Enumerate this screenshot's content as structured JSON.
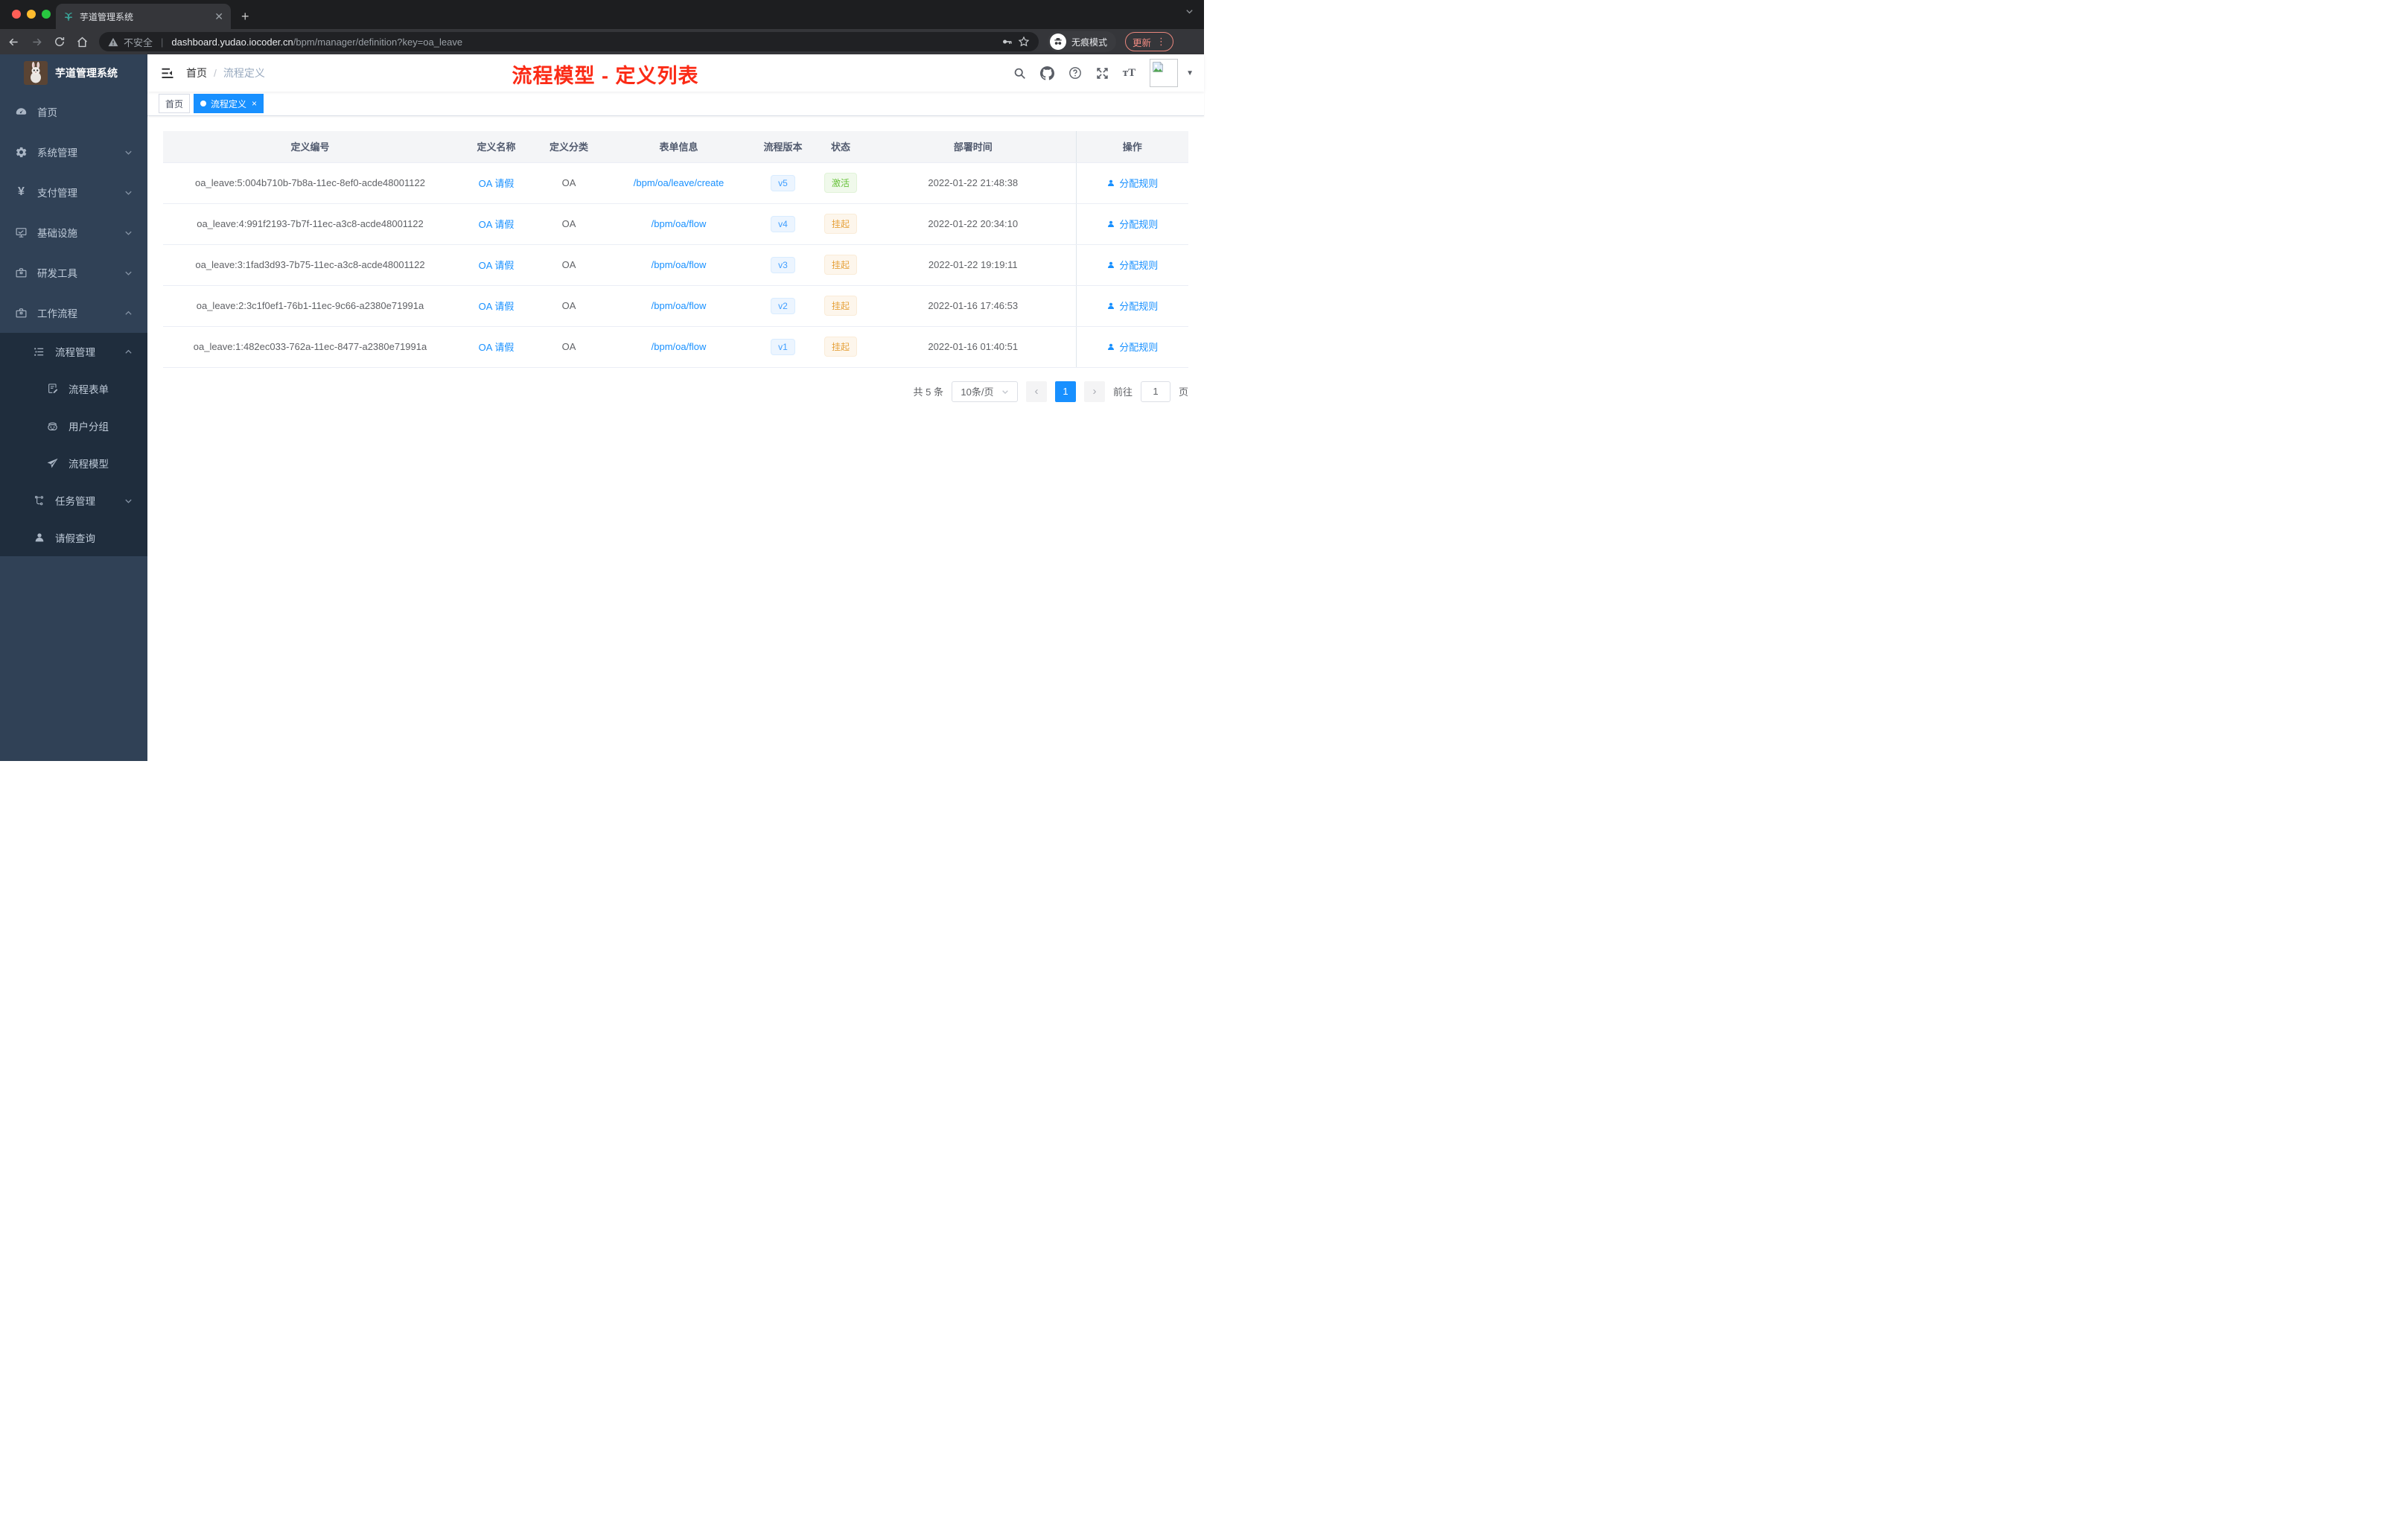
{
  "colors": {
    "primary": "#1890ff",
    "success": "#67c23a",
    "warning": "#e6a23c",
    "sidebar_bg": "#304156",
    "submenu_bg": "#1f2d3d",
    "annotation_red": "#fb2b16"
  },
  "browser": {
    "tab_title": "芋道管理系统",
    "security": "不安全",
    "url_domain": "dashboard.yudao.iocoder.cn",
    "url_path": "/bpm/manager/definition?key=oa_leave",
    "incognito": "无痕模式",
    "update": "更新"
  },
  "sidebar": {
    "app_title": "芋道管理系统",
    "items": [
      {
        "label": "首页",
        "icon": "dashboard-icon"
      },
      {
        "label": "系统管理",
        "icon": "gear-icon"
      },
      {
        "label": "支付管理",
        "icon": "yen-icon"
      },
      {
        "label": "基础设施",
        "icon": "monitor-icon"
      },
      {
        "label": "研发工具",
        "icon": "toolbox-icon"
      },
      {
        "label": "工作流程",
        "icon": "toolbox-icon"
      },
      {
        "label": "流程管理",
        "icon": "list-tree-icon"
      },
      {
        "label": "流程表单",
        "icon": "form-icon"
      },
      {
        "label": "用户分组",
        "icon": "user-group-icon"
      },
      {
        "label": "流程模型",
        "icon": "paper-plane-icon"
      },
      {
        "label": "任务管理",
        "icon": "task-tree-icon"
      },
      {
        "label": "请假查询",
        "icon": "person-icon"
      }
    ]
  },
  "navbar": {
    "breadcrumb_home": "首页",
    "breadcrumb_current": "流程定义",
    "annotation": "流程模型 - 定义列表"
  },
  "tags": {
    "home": "首页",
    "current": "流程定义"
  },
  "table": {
    "columns": [
      "定义编号",
      "定义名称",
      "定义分类",
      "表单信息",
      "流程版本",
      "状态",
      "部署时间",
      "操作"
    ],
    "rows": [
      {
        "id": "oa_leave:5:004b710b-7b8a-11ec-8ef0-acde48001122",
        "name": "OA 请假",
        "category": "OA",
        "form": "/bpm/oa/leave/create",
        "version": "v5",
        "status": "激活",
        "time": "2022-01-22 21:48:38",
        "action": "分配规则"
      },
      {
        "id": "oa_leave:4:991f2193-7b7f-11ec-a3c8-acde48001122",
        "name": "OA 请假",
        "category": "OA",
        "form": "/bpm/oa/flow",
        "version": "v4",
        "status": "挂起",
        "time": "2022-01-22 20:34:10",
        "action": "分配规则"
      },
      {
        "id": "oa_leave:3:1fad3d93-7b75-11ec-a3c8-acde48001122",
        "name": "OA 请假",
        "category": "OA",
        "form": "/bpm/oa/flow",
        "version": "v3",
        "status": "挂起",
        "time": "2022-01-22 19:19:11",
        "action": "分配规则"
      },
      {
        "id": "oa_leave:2:3c1f0ef1-76b1-11ec-9c66-a2380e71991a",
        "name": "OA 请假",
        "category": "OA",
        "form": "/bpm/oa/flow",
        "version": "v2",
        "status": "挂起",
        "time": "2022-01-16 17:46:53",
        "action": "分配规则"
      },
      {
        "id": "oa_leave:1:482ec033-762a-11ec-8477-a2380e71991a",
        "name": "OA 请假",
        "category": "OA",
        "form": "/bpm/oa/flow",
        "version": "v1",
        "status": "挂起",
        "time": "2022-01-16 01:40:51",
        "action": "分配规则"
      }
    ]
  },
  "pagination": {
    "total": "共 5 条",
    "page_size": "10条/页",
    "current": "1",
    "goto": "前往",
    "goto_value": "1",
    "unit": "页"
  }
}
